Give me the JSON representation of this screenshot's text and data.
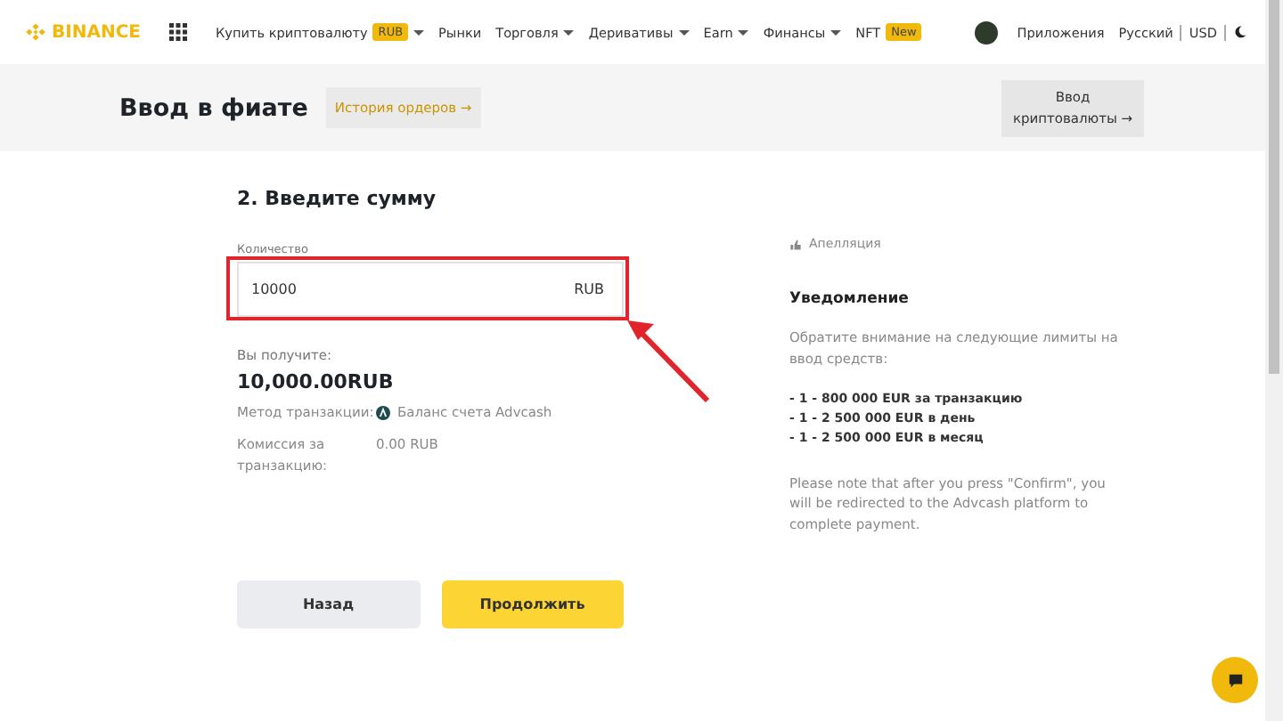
{
  "nav": {
    "logo": "BINANCE",
    "items": [
      {
        "label": "Купить криптовалюту",
        "badge": "RUB",
        "dropdown": true
      },
      {
        "label": "Рынки",
        "dropdown": false
      },
      {
        "label": "Торговля",
        "dropdown": true
      },
      {
        "label": "Деривативы",
        "dropdown": true
      },
      {
        "label": "Earn",
        "dropdown": true
      },
      {
        "label": "Финансы",
        "dropdown": true
      },
      {
        "label": "NFT",
        "badge": "New",
        "dropdown": false
      }
    ],
    "right": [
      "Приложения",
      "Русский",
      "USD"
    ]
  },
  "header": {
    "title": "Ввод в фиате",
    "history_button": "История ордеров →",
    "crypto_button": "Ввод криптовалюты →"
  },
  "form": {
    "step_title": "2. Введите сумму",
    "amount": {
      "label": "Количество",
      "value": "10000",
      "currency": "RUB"
    },
    "receive_label": "Вы получите:",
    "receive_value": "10,000.00RUB",
    "method_label": "Метод транзакции:",
    "method_value": "Баланс счета Advcash",
    "fee_label": "Комиссия за транзакцию:",
    "fee_value": "0.00 RUB"
  },
  "side": {
    "appeal": "Апелляция",
    "notice_title": "Уведомление",
    "notice_intro": "Обратите внимание на следующие лимиты на ввод средств:",
    "limits": [
      "- 1 - 800 000 EUR за транзакцию",
      "- 1 - 2 500 000 EUR в день",
      "- 1 - 2 500 000 EUR в месяц"
    ],
    "note": "Please note that after you press \"Confirm\", you will be redirected to the Advcash platform to complete payment."
  },
  "buttons": [
    {
      "label": "Назад",
      "kind": "secondary"
    },
    {
      "label": "Продолжить",
      "kind": "primary"
    }
  ]
}
